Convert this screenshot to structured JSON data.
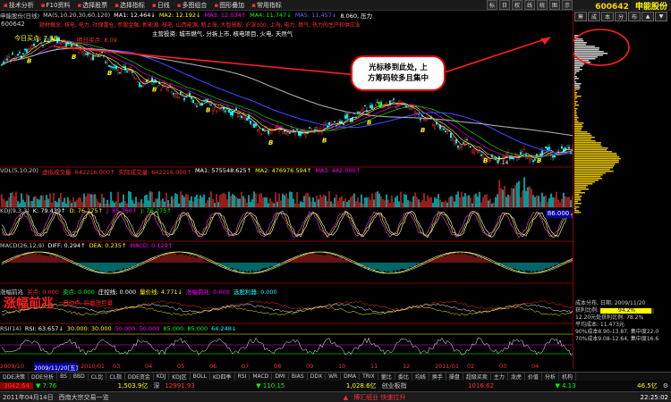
{
  "menu": [
    {
      "label": "技术分析",
      "icon": "▪"
    },
    {
      "label": "F10资料",
      "icon": "▪"
    },
    {
      "label": "选择股票",
      "icon": "▪"
    },
    {
      "label": "选择指标",
      "icon": "▪"
    },
    {
      "label": "日线",
      "icon": "▪"
    },
    {
      "label": "多图组合",
      "icon": "▪"
    },
    {
      "label": "图形叠加",
      "icon": "▪"
    },
    {
      "label": "常用指标",
      "icon": "▪"
    }
  ],
  "tool_buttons": [
    "标",
    "日",
    "权",
    "线",
    "统",
    "图",
    "示"
  ],
  "stock": {
    "code": "600642",
    "name": "申能股份"
  },
  "ma_line": {
    "header": "申能股份(日线)",
    "ma_spec": "MA(5,10,20,30,60,120)",
    "items": [
      "MA1: 12.464↓",
      "MA2: 12.192↓",
      "MA3: 12.034↑",
      "MA4: 11.747↓",
      "MA5: 11.457↓",
      "8.060, 压力"
    ]
  },
  "price_panel": {
    "code_label": "600642",
    "today_buy": "今日买点: 7.98",
    "notes_line": "题材概念: 核电, 电力, 社保重仓, 参股金融, 新能源, 核电, 山西能源, 新上海, 大智慧股, 沪深300, 上海, 电力, 燃气, 热力的生产和供应业",
    "main_invest": "主营投资: 城市燃气, 分拆上市, 核电项目, 火电, 天然气",
    "tomorrow_buy": "明日买点: 8.09",
    "markers": [
      "B",
      "B",
      "B",
      "B",
      "B",
      "B",
      "B",
      "B",
      "B",
      "B",
      "B",
      "S"
    ],
    "low_label": "7.14"
  },
  "callout": {
    "line1": "光标移到此处, 上",
    "line2": "方筹码较多且集中"
  },
  "vol_panel": {
    "title": "VOL(5,10,20)",
    "items": [
      "虚拟成交量: 642216.000↑",
      "实际成交量: 642216.000↑",
      "MA1: 575548.625↑",
      "MA2: 476976.594↑",
      "MA3: 482.000↑"
    ]
  },
  "kdj_panel": {
    "title": "KDJ(9,3,3)",
    "items": [
      "K: 79.439↑",
      "D: 76.275↑",
      "J: 85.766↑",
      "J: 76.275↑"
    ],
    "value_box": "86.000"
  },
  "macd_panel": {
    "title": "MACD(26,12,9)",
    "items": [
      "DIFF: 0.294↑",
      "DEA: 0.235↑",
      "MACD: 0.129↑"
    ]
  },
  "zfqz_panel": {
    "title": "涨幅前兆",
    "items": [
      "买点: 0.000",
      "卖点: 0.000",
      "庄控线: 0.000",
      "量价线: 4.771↓",
      "涨幅前兆: 0.000",
      "选股利器: 0.000"
    ],
    "big_label": "涨幅前兆",
    "small_label": "启动点, 后量放巨量"
  },
  "rsi_panel": {
    "title": "RSI(14)",
    "items": [
      "RSI: 63.657↓",
      "30.000: 30.000",
      "50.000: 50.000",
      "85.000: 85.000",
      "64.248↓"
    ]
  },
  "dates": {
    "labels": [
      "2009/10",
      "2009/11/20[五]",
      "2010/01",
      "03",
      "04",
      "05",
      "06",
      "07",
      "08",
      "09",
      "10",
      "11",
      "12",
      "2011/01",
      "02",
      "03",
      "04"
    ]
  },
  "chip_panel": {
    "date_line": "成本分布, 日期: 2009/11/20",
    "profit_line": "获利比例:",
    "profit_val": "94.2%",
    "ratio_line": "12.20元处获利比例: 78.2%",
    "avg_cost": "平均成本: 11.473元",
    "cost90": "90%成本8.90-13.87, 集中度22.0",
    "cost70": "70%成本9.08-12.64, 集中度16.6"
  },
  "tabs": [
    "DDE决策",
    "DDE分析",
    "BS",
    "BBD",
    "CL比",
    "CL指",
    "DDE资金",
    "KDJ",
    "KDJ区",
    "BOLL",
    "KD四季",
    "RSI",
    "MACD",
    "DMI",
    "BIAS",
    "DDX",
    "WR",
    "DMA",
    "TRIX",
    "量比",
    "委比",
    "均线",
    "换手",
    "操盘",
    "超级买卖",
    "主力",
    "龙虎",
    "价值",
    "分析",
    "机构"
  ],
  "index_bar": {
    "sh_val": "3042.64",
    "sh_chg": "▼ 7.76",
    "sh_amt": "1,503.9亿",
    "sh_label": "深",
    "sz_val": "12991.93",
    "sz_chg": "▼ 110.15",
    "sz_amt": "1,028.6亿",
    "cy_label": "创业板指",
    "cy_val": "1016.62",
    "cy_chg": "▼ 4.13",
    "cy_amt": "46.5亿"
  },
  "status": {
    "date": "2011年04月14日",
    "notice": "西南大宗交易一览",
    "right_text": "博汇纸业 快速拉升",
    "time": "22:25:02"
  },
  "colors": {
    "bg": "#000000",
    "ma1": "#ffffff",
    "ma2": "#ffff00",
    "ma3": "#ff00ff",
    "ma4": "#00ff00",
    "ma5": "#4040ff",
    "ma6": "#aaaaaa",
    "red": "#ff2020",
    "cyan": "#00ffff",
    "yellow": "#ffff00",
    "green": "#00c000",
    "magenta": "#ff40ff"
  }
}
